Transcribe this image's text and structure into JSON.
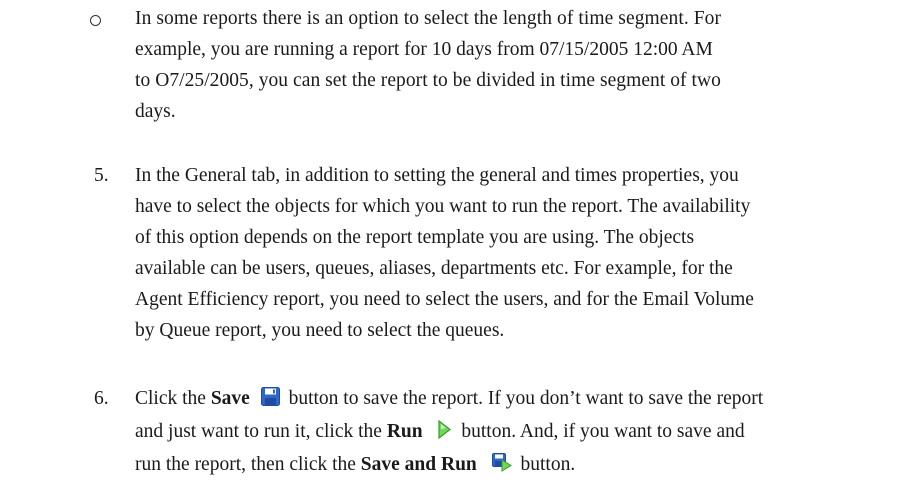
{
  "bullet": {
    "lines": [
      "In some reports there is an option to select the length of time segment. For",
      "example, you are running a report for 10 days from 07/15/2005 12:00 AM",
      "to O7/25/2005, you can set the report to be divided in time segment of two",
      "days."
    ]
  },
  "step5": {
    "number": "5.",
    "lines": [
      "In the General tab, in addition to setting the general and times properties, you",
      "have to select the objects for which you want to run the report. The availability",
      "of this option depends on the report template you are using. The objects",
      "available can be users, queues, aliases, departments etc. For example, for the",
      "Agent Efficiency report, you need to select the users, and for the Email Volume",
      "by Queue report, you need to select the queues."
    ]
  },
  "step6": {
    "number": "6.",
    "l1_a": "Click the ",
    "l1_save": "Save",
    "l1_b": " button to save the report. If you don’t want to save the report",
    "l2_a": "and just want to run it, click the ",
    "l2_run": "Run",
    "l2_b": " button. And, if you want to save and",
    "l3_a": "run the report, then click the ",
    "l3_saverun": "Save and Run",
    "l3_b": " button."
  },
  "icons": {
    "save": "floppy-disk-icon",
    "run": "green-play-arrow-icon",
    "save_and_run": "floppy-with-arrow-icon"
  },
  "colors": {
    "icon_blue": "#2f67c8",
    "icon_green": "#3fbf2c",
    "text": "#1a1a1a"
  }
}
